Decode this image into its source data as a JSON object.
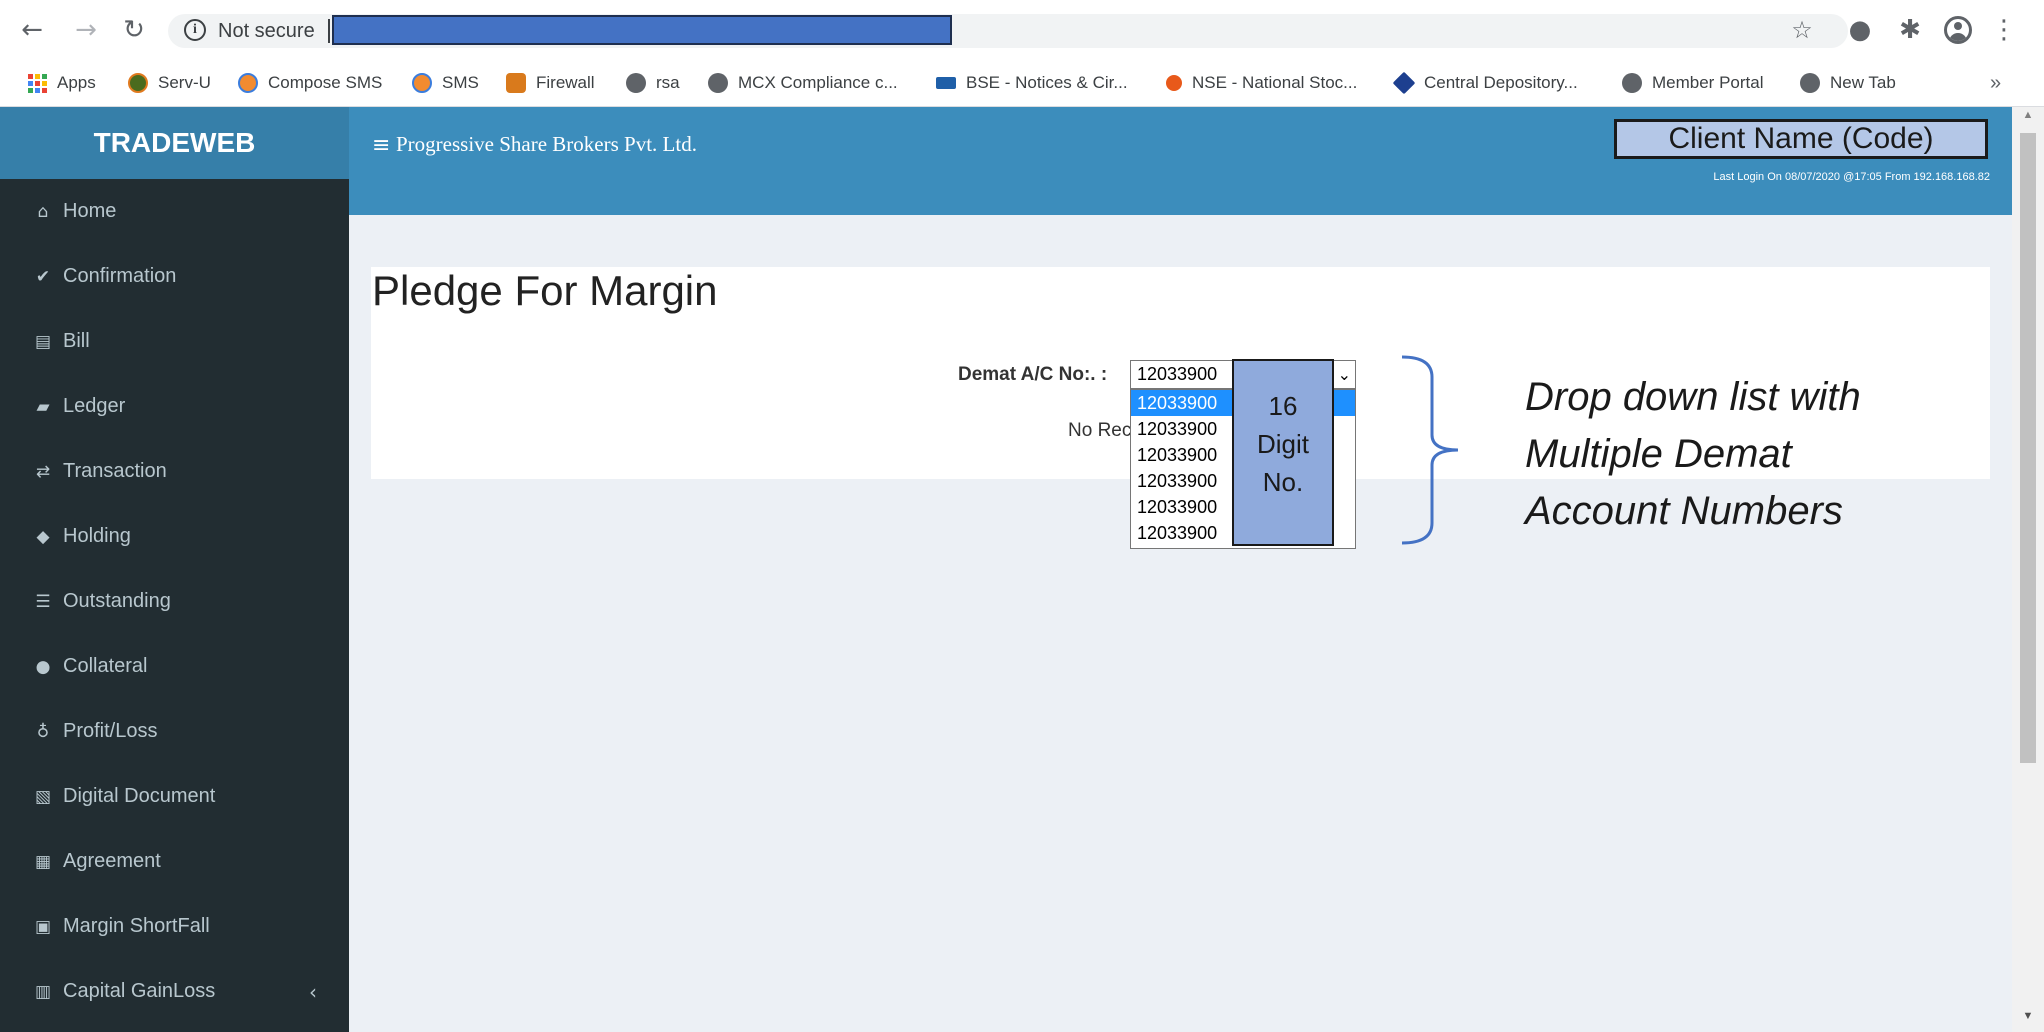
{
  "browser": {
    "security_label": "Not secure",
    "bookmarks": [
      {
        "label": "Apps",
        "icon": "apps-grid-icon"
      },
      {
        "label": "Serv-U",
        "icon": "serv-u-icon"
      },
      {
        "label": "Compose SMS",
        "icon": "sms-icon"
      },
      {
        "label": "SMS",
        "icon": "sms-icon"
      },
      {
        "label": "Firewall",
        "icon": "firewall-icon"
      },
      {
        "label": "rsa",
        "icon": "globe-icon"
      },
      {
        "label": "MCX Compliance c...",
        "icon": "globe-icon"
      },
      {
        "label": "BSE - Notices & Cir...",
        "icon": "bse-icon"
      },
      {
        "label": "NSE - National Stoc...",
        "icon": "nse-icon"
      },
      {
        "label": "Central Depository...",
        "icon": "cdsl-icon"
      },
      {
        "label": "Member Portal",
        "icon": "globe-icon"
      },
      {
        "label": "New Tab",
        "icon": "globe-icon"
      }
    ],
    "more_label": "»"
  },
  "header": {
    "logo": "TRADEWEB",
    "company": "Progressive Share Brokers Pvt. Ltd.",
    "client_name": "Client Name (Code)",
    "last_login": "Last Login On 08/07/2020 @17:05 From 192.168.168.82"
  },
  "sidebar": {
    "items": [
      {
        "label": "Home",
        "icon": "home-icon"
      },
      {
        "label": "Confirmation",
        "icon": "check-circle-icon"
      },
      {
        "label": "Bill",
        "icon": "file-text-icon"
      },
      {
        "label": "Ledger",
        "icon": "book-icon"
      },
      {
        "label": "Transaction",
        "icon": "exchange-icon"
      },
      {
        "label": "Holding",
        "icon": "tag-icon"
      },
      {
        "label": "Outstanding",
        "icon": "list-icon"
      },
      {
        "label": "Collateral",
        "icon": "comment-icon"
      },
      {
        "label": "Profit/Loss",
        "icon": "thumbs-up-icon"
      },
      {
        "label": "Digital Document",
        "icon": "pdf-icon"
      },
      {
        "label": "Agreement",
        "icon": "newspaper-icon"
      },
      {
        "label": "Margin ShortFall",
        "icon": "address-book-icon"
      },
      {
        "label": "Capital GainLoss",
        "icon": "bar-chart-icon"
      }
    ],
    "chevron": "‹"
  },
  "main": {
    "title": "Pledge For Margin",
    "demat_label": "Demat A/C No:. :",
    "selected_value": "12033900",
    "options": [
      "12033900",
      "12033900",
      "12033900",
      "12033900",
      "12033900",
      "12033900"
    ],
    "no_records": "No Rec"
  },
  "annotations": {
    "digit_line1": "16",
    "digit_line2": "Digit",
    "digit_line3": "No.",
    "dropdown_line1": "Drop down list with",
    "dropdown_line2": "Multiple Demat",
    "dropdown_line3": "Account Numbers"
  },
  "colors": {
    "header": "#3c8dbc",
    "logo_bg": "#367fa9",
    "sidebar": "#222d32",
    "selected_option": "#1e90ff",
    "redact": "#4472c4",
    "callout": "#8faadc",
    "client_box": "#b4c7e7"
  }
}
